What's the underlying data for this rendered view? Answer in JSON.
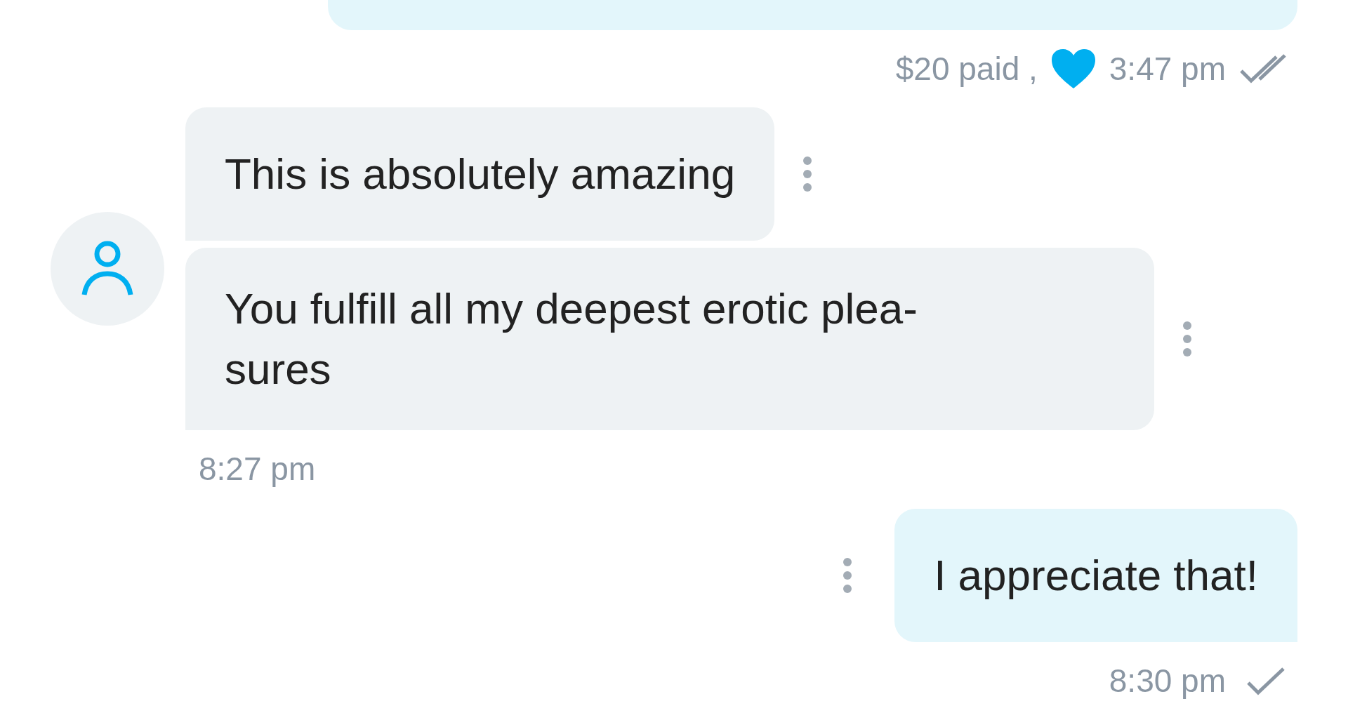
{
  "conversation": [
    {
      "kind": "sent_cut",
      "meta": {
        "price": "$20 paid ,",
        "liked": true,
        "time": "3:47 pm",
        "read": true
      }
    },
    {
      "kind": "received",
      "bubbles": [
        "This is absolutely amazing",
        "You fulfill all my deepest erotic plea-\nsures"
      ],
      "time": "8:27 pm"
    },
    {
      "kind": "sent",
      "bubbles": [
        "I appreciate that!"
      ],
      "meta": {
        "time": "8:30 pm",
        "read": false
      }
    }
  ]
}
